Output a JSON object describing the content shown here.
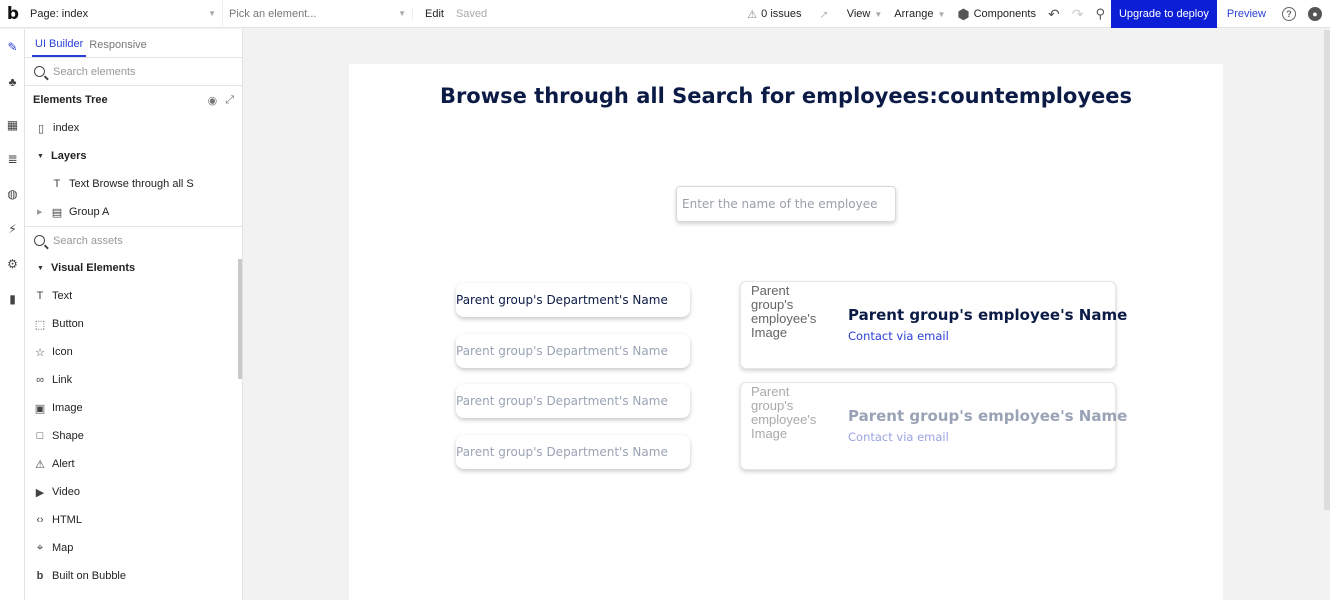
{
  "toolbar": {
    "logo": "b",
    "page_select": "Page: index",
    "element_select_placeholder": "Pick an element...",
    "edit_label": "Edit",
    "status": "Saved",
    "issues": "0 issues",
    "view_label": "View",
    "arrange_label": "Arrange",
    "components_label": "Components",
    "deploy_label": "Upgrade to deploy",
    "preview_label": "Preview"
  },
  "rail": {
    "icons": [
      "pencil-icon",
      "hierarchy-icon",
      "layout-icon",
      "database-icon",
      "palette-icon",
      "plug-icon",
      "settings-icon",
      "analytics-icon"
    ]
  },
  "panel": {
    "tabs": [
      "UI Builder",
      "Responsive"
    ],
    "search_placeholder": "Search elements",
    "elements_tree_label": "Elements Tree",
    "tree": {
      "index": "index",
      "layers": "Layers",
      "text_item": "Text Browse through all S",
      "group_item": "Group A"
    },
    "assets_placeholder": "Search assets",
    "visual_elements_label": "Visual Elements",
    "visual_elements": [
      {
        "label": "Text",
        "icon": "text-icon"
      },
      {
        "label": "Button",
        "icon": "button-icon"
      },
      {
        "label": "Icon",
        "icon": "star-icon"
      },
      {
        "label": "Link",
        "icon": "link-icon"
      },
      {
        "label": "Image",
        "icon": "image-icon"
      },
      {
        "label": "Shape",
        "icon": "square-icon"
      },
      {
        "label": "Alert",
        "icon": "warning-icon"
      },
      {
        "label": "Video",
        "icon": "video-icon"
      },
      {
        "label": "HTML",
        "icon": "code-icon"
      },
      {
        "label": "Map",
        "icon": "map-pin-icon"
      },
      {
        "label": "Built on Bubble",
        "icon": "bubble-logo-icon"
      }
    ]
  },
  "canvas": {
    "title": "Browse through all Search for employees:countemployees",
    "input_placeholder": "Enter the name of the employee",
    "departments": [
      "Parent group's Department's Name",
      "Parent group's Department's Name",
      "Parent group's Department's Name",
      "Parent group's Department's Name"
    ],
    "cards": [
      {
        "image_alt": "Parent group's employee's Image",
        "name": "Parent group's employee's Name",
        "contact": "Contact via email"
      },
      {
        "image_alt": "Parent group's employee's Image",
        "name": "Parent group's employee's Name",
        "contact": "Contact via email"
      }
    ]
  }
}
